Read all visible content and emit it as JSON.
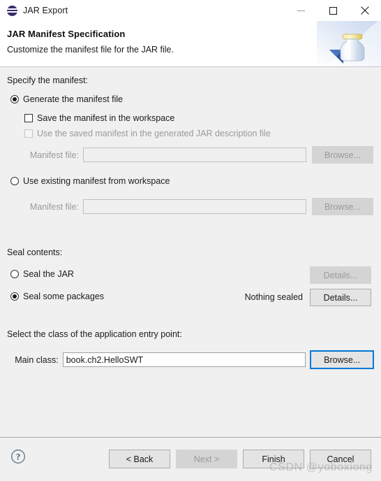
{
  "window": {
    "title": "JAR Export",
    "icon": "eclipse-icon",
    "controls": {
      "minimize": "minimize-icon",
      "maximize": "maximize-icon",
      "close": "close-icon"
    }
  },
  "header": {
    "title": "JAR Manifest Specification",
    "subtitle": "Customize the manifest file for the JAR file.",
    "art": "jar-bottle-icon"
  },
  "manifest": {
    "section_label": "Specify the manifest:",
    "generate_option": "Generate the manifest file",
    "generate_selected": true,
    "save_in_workspace": "Save the manifest in the workspace",
    "save_checked": false,
    "use_saved_in_jardesc": "Use the saved manifest in the generated JAR description file",
    "use_saved_checked": false,
    "manifest_file_label_1": "Manifest file:",
    "manifest_file_value_1": "",
    "browse_1": "Browse...",
    "use_existing_option": "Use existing manifest from workspace",
    "use_existing_selected": false,
    "manifest_file_label_2": "Manifest file:",
    "manifest_file_value_2": "",
    "browse_2": "Browse..."
  },
  "seal": {
    "section_label": "Seal contents:",
    "seal_jar_option": "Seal the JAR",
    "seal_jar_selected": false,
    "seal_jar_details": "Details...",
    "seal_packages_option": "Seal some packages",
    "seal_packages_selected": true,
    "seal_packages_status": "Nothing sealed",
    "seal_packages_details": "Details..."
  },
  "entry_point": {
    "section_label": "Select the class of the application entry point:",
    "main_class_label": "Main class:",
    "main_class_value": "book.ch2.HelloSWT",
    "browse": "Browse..."
  },
  "footer": {
    "help": "help-icon",
    "back": "< Back",
    "next": "Next >",
    "finish": "Finish",
    "cancel": "Cancel",
    "next_disabled": true
  },
  "watermark": {
    "text": "CSDN @yoboxiong"
  },
  "colors": {
    "focus_accent": "#0078d7",
    "panel_background": "#f0f0f0",
    "header_background": "#ffffff",
    "disabled_text": "#9a9a9a"
  }
}
